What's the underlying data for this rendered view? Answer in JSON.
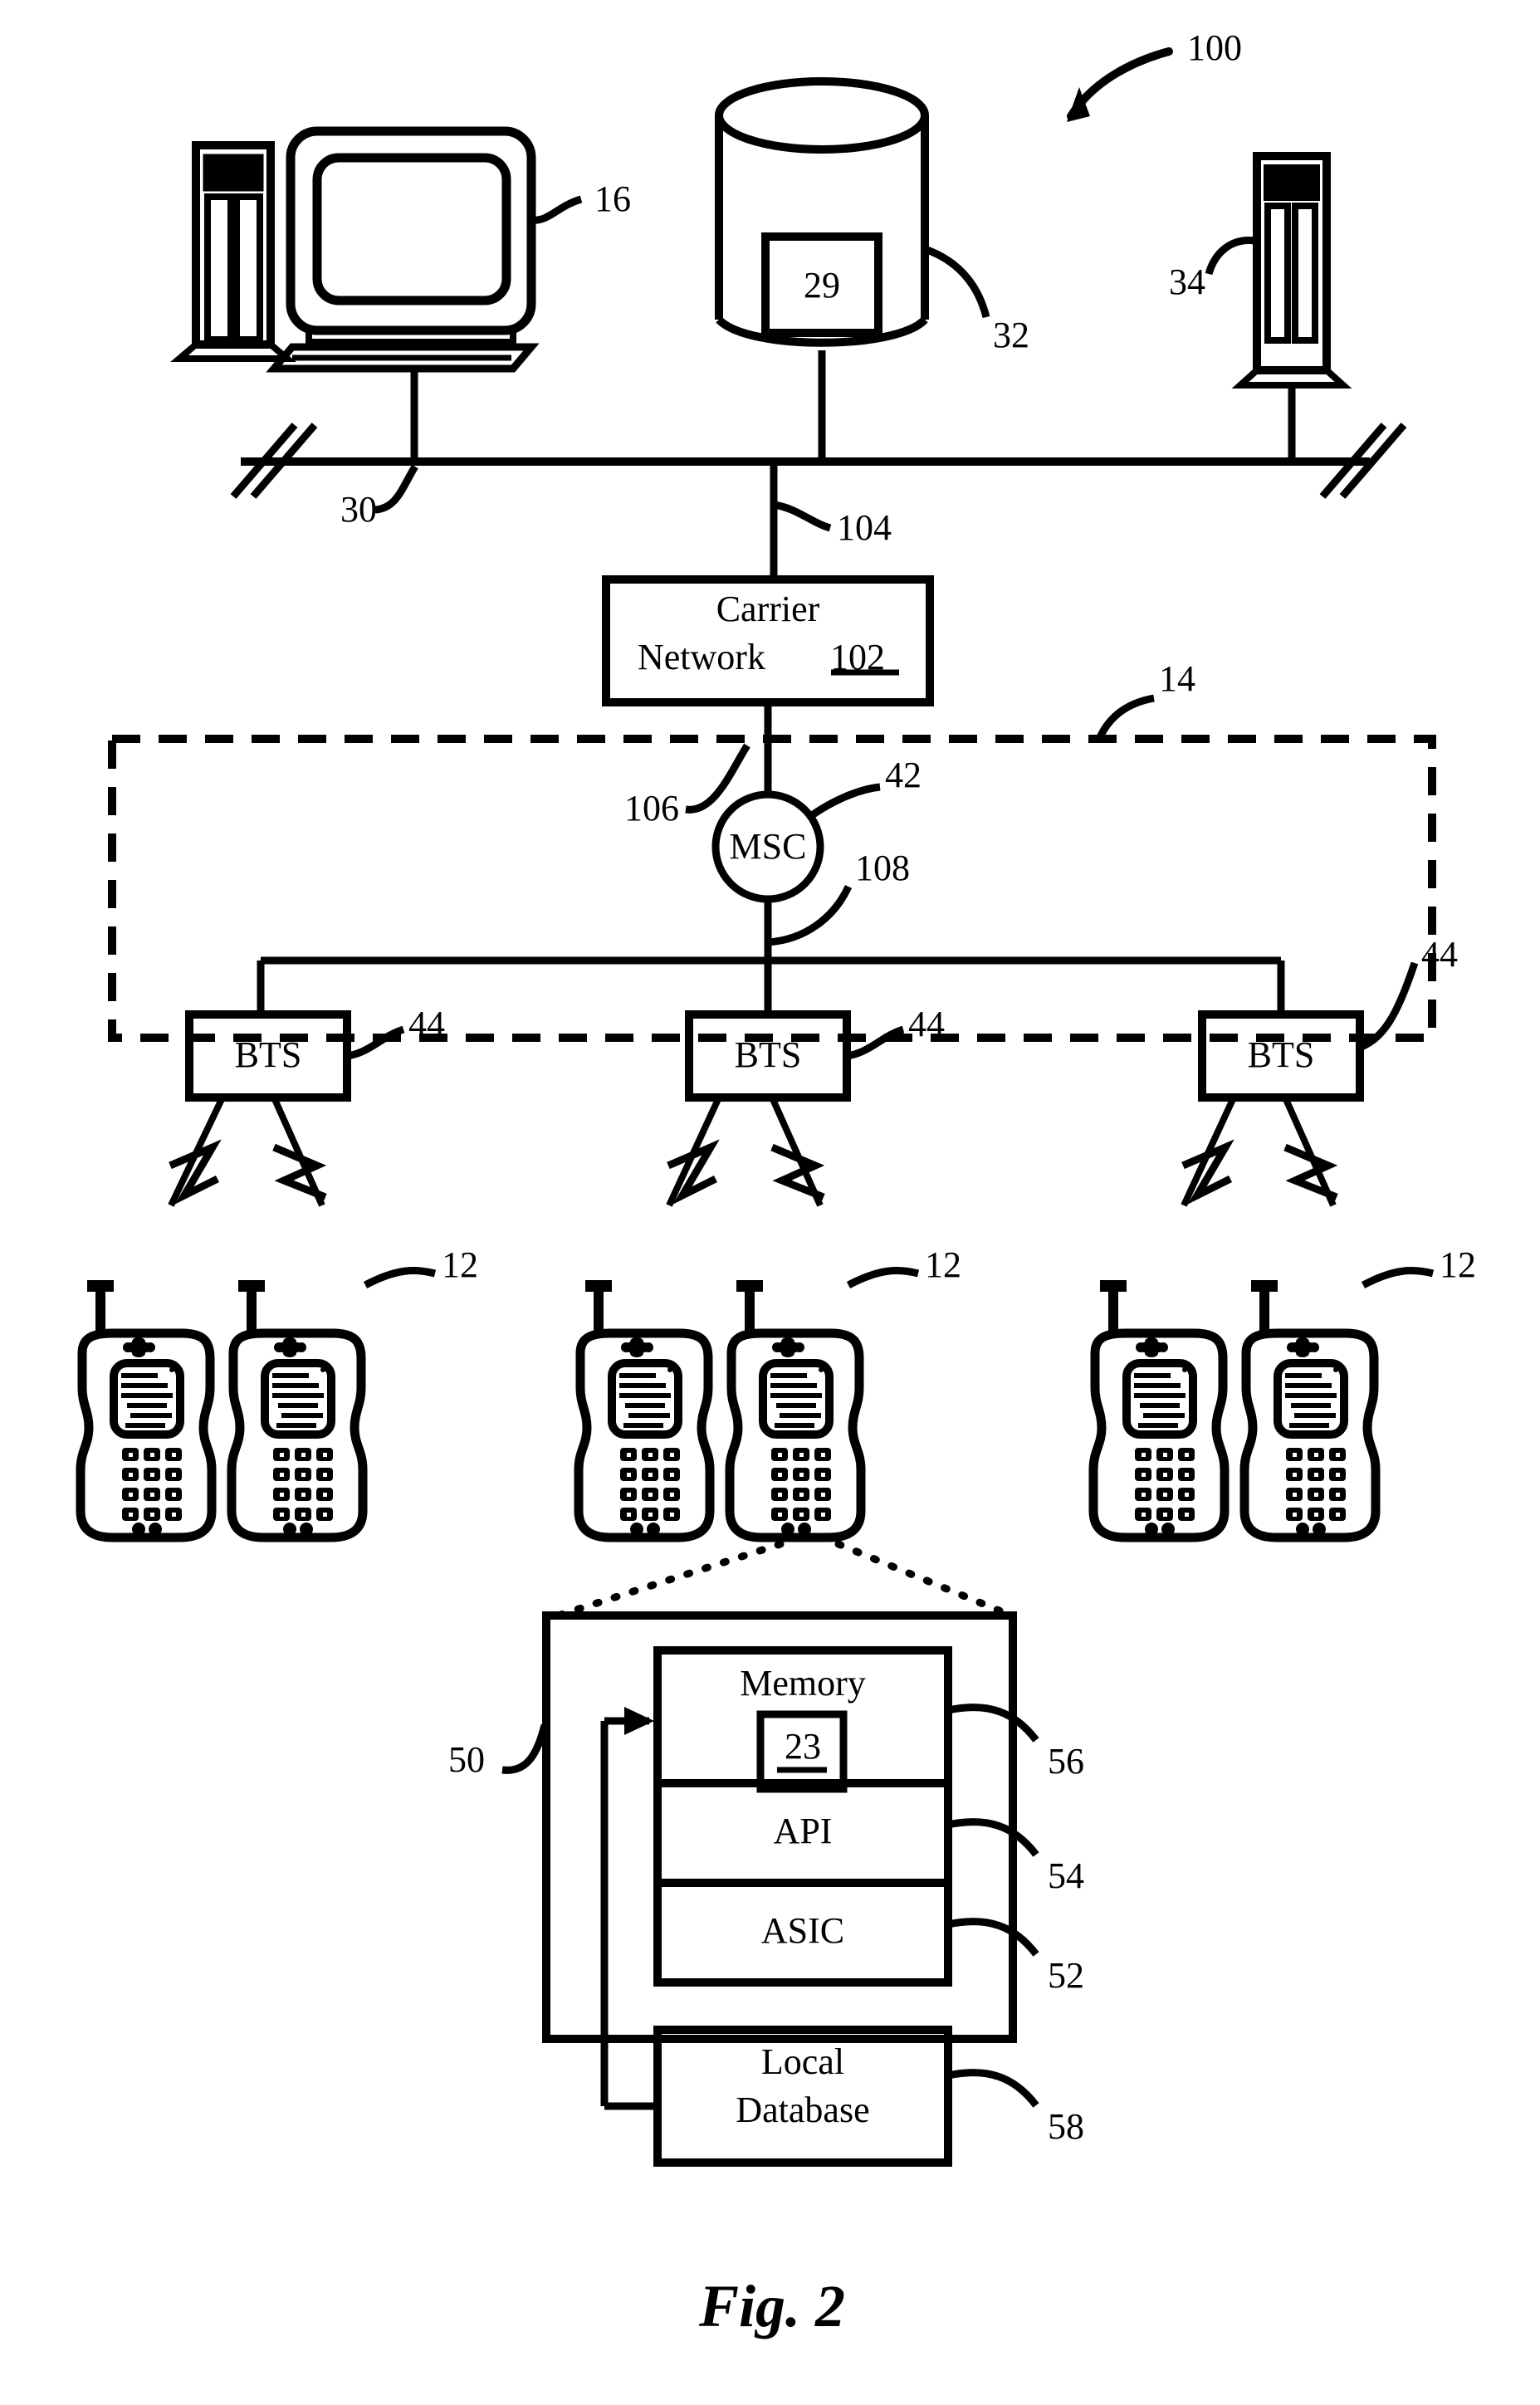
{
  "figure": {
    "caption": "Fig. 2",
    "title_number": "100"
  },
  "nodes": {
    "workstation": {
      "ref": "16",
      "icon": "desktop-computer-icon"
    },
    "database": {
      "ref": "32",
      "inner_ref": "29",
      "icon": "database-cylinder-icon"
    },
    "server": {
      "ref": "34",
      "icon": "server-tower-icon"
    },
    "bus": {
      "ref": "30"
    },
    "bus_to_carrier": {
      "ref": "104"
    },
    "carrier_network": {
      "label_line1": "Carrier",
      "label_line2": "Network",
      "ref": "102"
    },
    "carrier_to_msc": {
      "ref": "106"
    },
    "wireless_network_boundary": {
      "ref": "14"
    },
    "msc": {
      "label": "MSC",
      "ref": "42"
    },
    "msc_backhaul": {
      "ref": "108"
    },
    "bts_left": {
      "label": "BTS",
      "ref": "44"
    },
    "bts_center": {
      "label": "BTS",
      "ref": "44"
    },
    "bts_right": {
      "label": "BTS",
      "ref": "44"
    },
    "handsets": [
      {
        "ref": ""
      },
      {
        "ref": "12"
      },
      {
        "ref": ""
      },
      {
        "ref": "12"
      },
      {
        "ref": ""
      },
      {
        "ref": "12"
      }
    ]
  },
  "detail": {
    "outer_ref": "50",
    "blocks": [
      {
        "label": "Memory",
        "inner_ref": "23",
        "ref": "56"
      },
      {
        "label": "API",
        "ref": "54"
      },
      {
        "label": "ASIC",
        "ref": "52"
      },
      {
        "label_line1": "Local",
        "label_line2": "Database",
        "ref": "58"
      }
    ]
  },
  "colors": {
    "ink": "#000000",
    "paper": "#ffffff"
  }
}
